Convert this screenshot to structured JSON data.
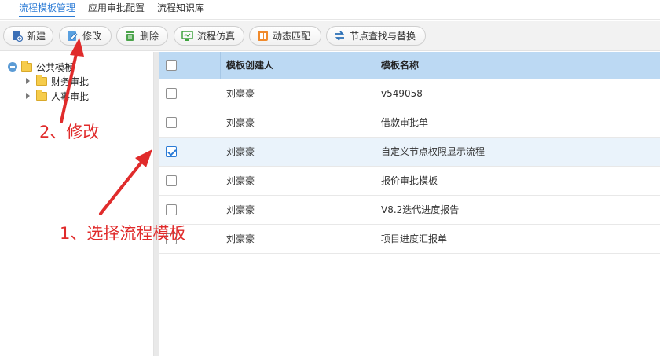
{
  "tabs": [
    {
      "label": "流程模板管理",
      "active": true
    },
    {
      "label": "应用审批配置",
      "active": false
    },
    {
      "label": "流程知识库",
      "active": false
    }
  ],
  "toolbar": {
    "new_label": "新建",
    "edit_label": "修改",
    "delete_label": "删除",
    "simulate_label": "流程仿真",
    "dynamic_match_label": "动态匹配",
    "find_replace_label": "节点查找与替换"
  },
  "tree": {
    "root_label": "公共模板",
    "children": [
      {
        "label": "财务审批"
      },
      {
        "label": "人事审批"
      }
    ]
  },
  "grid": {
    "columns": [
      "模板创建人",
      "模板名称"
    ],
    "rows": [
      {
        "creator": "刘豪豪",
        "name": "v549058",
        "checked": false
      },
      {
        "creator": "刘豪豪",
        "name": "借款审批单",
        "checked": false
      },
      {
        "creator": "刘豪豪",
        "name": "自定义节点权限显示流程",
        "checked": true
      },
      {
        "creator": "刘豪豪",
        "name": "报价审批模板",
        "checked": false
      },
      {
        "creator": "刘豪豪",
        "name": "V8.2迭代进度报告",
        "checked": false
      },
      {
        "creator": "刘豪豪",
        "name": "项目进度汇报单",
        "checked": false
      }
    ]
  },
  "annotations": {
    "step1": "1、选择流程模板",
    "step2": "2、修改",
    "color": "#e02b2b"
  }
}
